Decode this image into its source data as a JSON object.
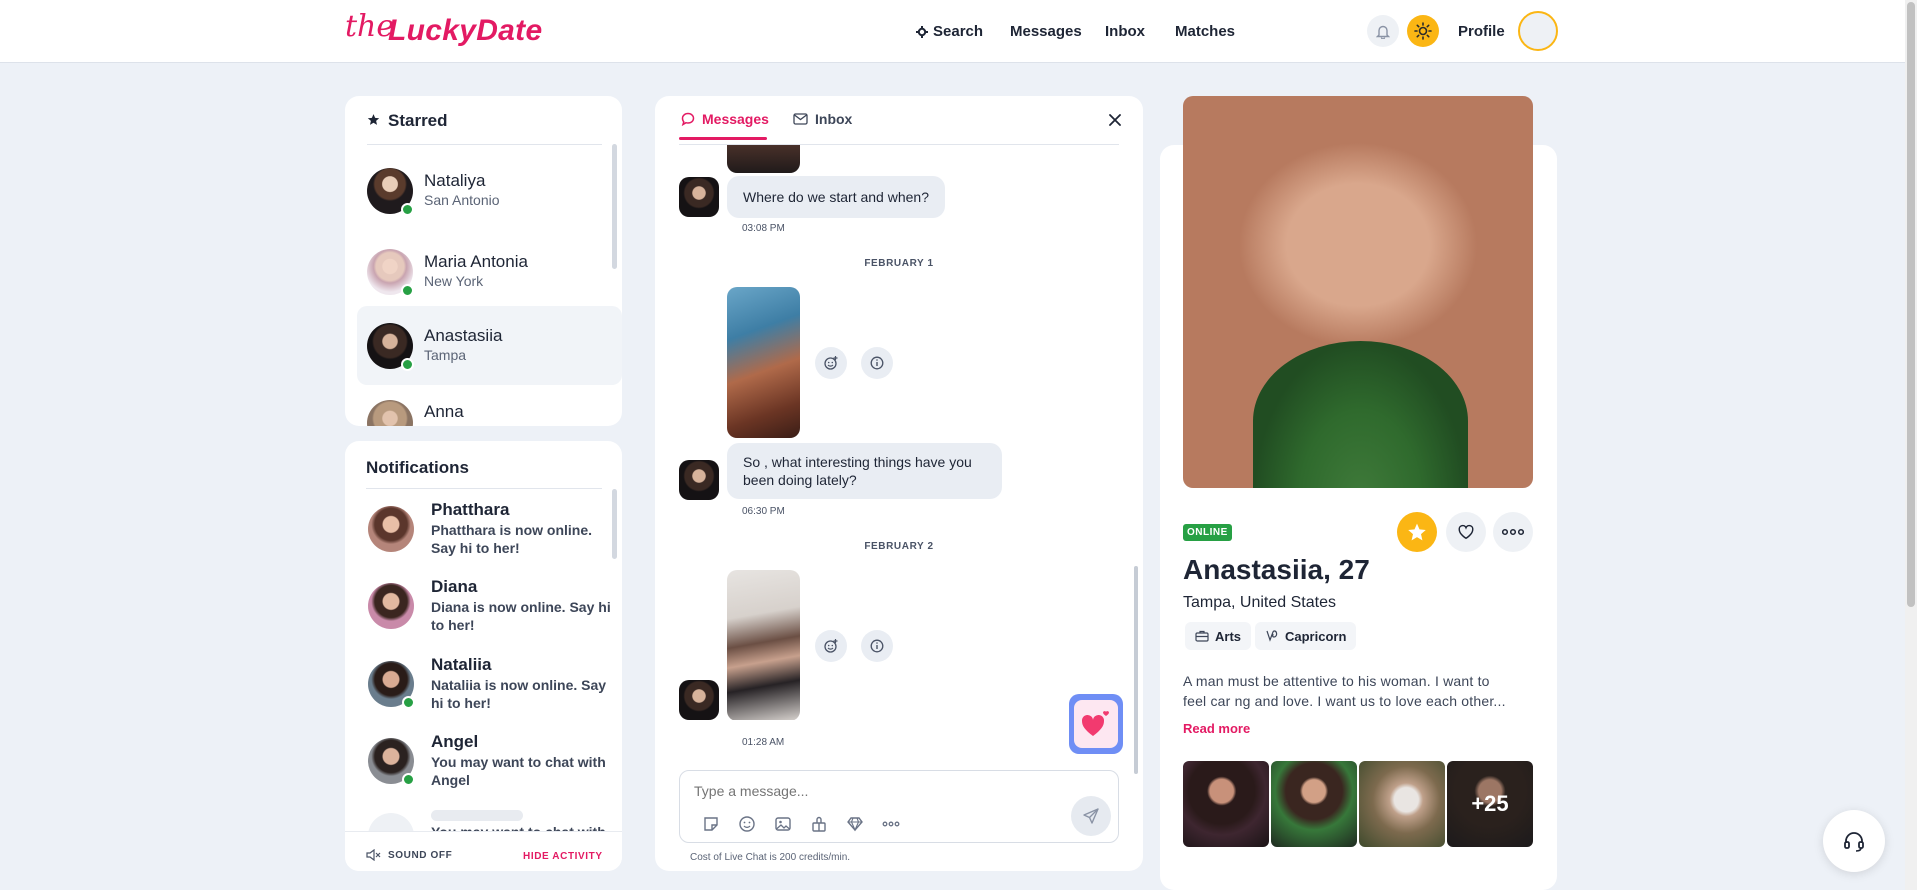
{
  "brand": {
    "prefix": "the",
    "name": "LuckyDate"
  },
  "nav": {
    "search": "Search",
    "messages": "Messages",
    "inbox": "Inbox",
    "matches": "Matches",
    "profile": "Profile"
  },
  "icons": {
    "search": "gear-icon",
    "bell": "bell-icon",
    "theme": "sun-icon",
    "star": "star-icon",
    "close": "close-icon",
    "support": "headset-icon"
  },
  "colors": {
    "brand": "#e31a63",
    "online": "#27a044",
    "gold": "#fbb614",
    "bg": "#edf1f7"
  },
  "starred": {
    "title": "Starred",
    "items": [
      {
        "name": "Nataliya",
        "city": "San Antonio",
        "online": true
      },
      {
        "name": "Maria Antonia",
        "city": "New York",
        "online": true
      },
      {
        "name": "Anastasiia",
        "city": "Tampa",
        "online": true,
        "selected": true
      },
      {
        "name": "Anna",
        "city": ""
      }
    ]
  },
  "notifications": {
    "title": "Notifications",
    "items": [
      {
        "name": "Phatthara",
        "line1": "Phatthara is now online.",
        "line2": "Say hi to her!"
      },
      {
        "name": "Diana",
        "line1": "Diana is now online. Say hi",
        "line2": "to her!"
      },
      {
        "name": "Nataliia",
        "line1": "Nataliia is now online. Say",
        "line2": "hi to her!"
      },
      {
        "name": "Angel",
        "line1": "You may want to chat with",
        "line2": "Angel"
      },
      {
        "name": "",
        "line1": "You may want to chat with",
        "line2": ""
      }
    ],
    "sound": "SOUND OFF",
    "hide": "HIDE ACTIVITY"
  },
  "chat": {
    "tabs": {
      "messages": "Messages",
      "inbox": "Inbox"
    },
    "msg1": "Where do we start and when?",
    "time1": "03:08 PM",
    "date1": "FEBRUARY 1",
    "msg2_line1": "So , what interesting things have you",
    "msg2_line2": "been doing lately?",
    "time2": "06:30 PM",
    "date2": "FEBRUARY 2",
    "time3": "01:28 AM",
    "placeholder": "Type a message...",
    "cost": "Cost of Live Chat is 200 credits/min."
  },
  "profile": {
    "status": "ONLINE",
    "name_age": "Anastasiia, 27",
    "location": "Tampa, United States",
    "tags": [
      "Arts",
      "Capricorn"
    ],
    "bio_line1": "A man must be attentive to his woman. I want to",
    "bio_line2": "feel car ng and love. I want us to love each other...",
    "read_more": "Read more",
    "more_photos": "+25"
  }
}
